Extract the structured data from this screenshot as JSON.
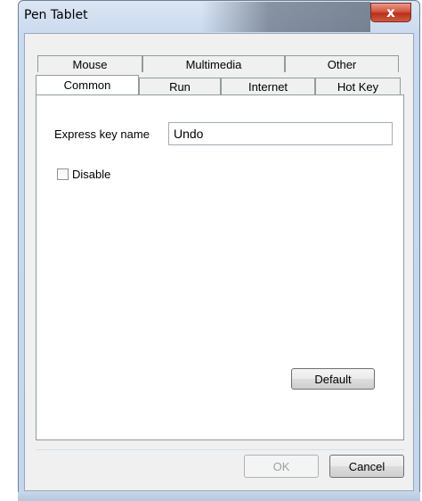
{
  "window": {
    "title": "Pen Tablet",
    "close_label": "x"
  },
  "tabs": {
    "row_top": [
      "Mouse",
      "Multimedia",
      "Other"
    ],
    "row_bottom": [
      "Common",
      "Run",
      "Internet",
      "Hot Key"
    ],
    "active": "Common"
  },
  "panel": {
    "express_key_label": "Express key name",
    "express_key_value": "Undo",
    "disable_label": "Disable",
    "disable_checked": false,
    "default_button": "Default"
  },
  "footer": {
    "ok_button": "OK",
    "ok_enabled": false,
    "cancel_button": "Cancel"
  },
  "colors": {
    "close_button": "#c94a33",
    "frame": "#c9d9ee",
    "client": "#f0f0f0"
  }
}
